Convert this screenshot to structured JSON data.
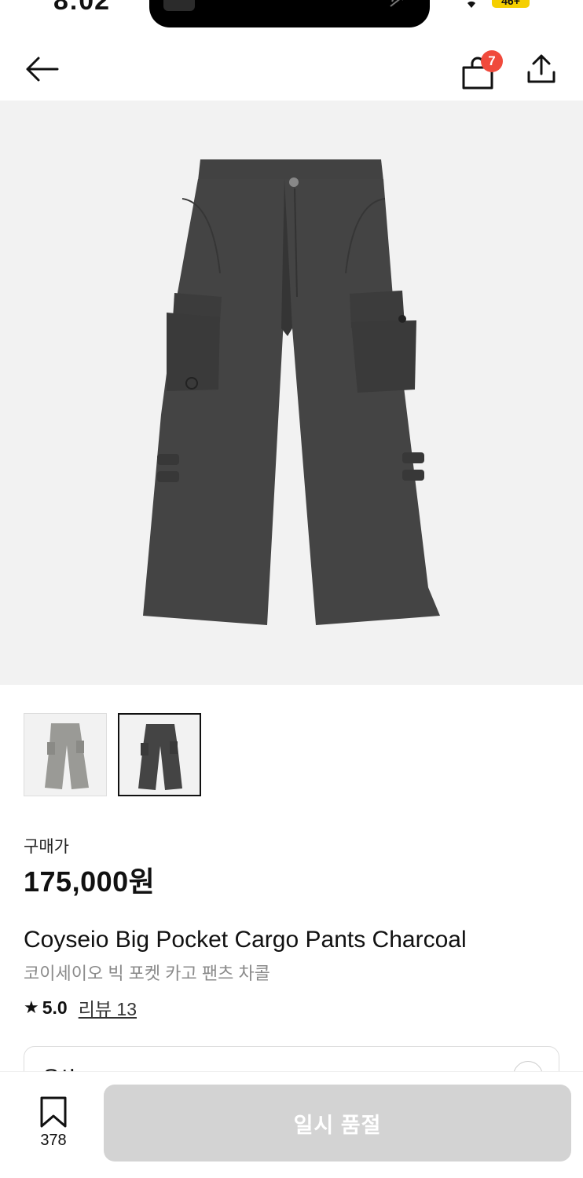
{
  "status": {
    "time": "8:02",
    "battery": "46+"
  },
  "nav": {
    "cart_count": "7"
  },
  "product": {
    "price_label": "구매가",
    "price": "175,000원",
    "name_en": "Coyseio Big Pocket Cargo Pants Charcoal",
    "name_ko": "코이세이오 빅 포켓 카고 팬츠 차콜",
    "rating": "5.0",
    "reviews": "리뷰 13"
  },
  "option": {
    "label": "옵션"
  },
  "bottom": {
    "bookmark_count": "378",
    "cta_label": "일시 품절"
  },
  "colors": {
    "badge": "#f04a3c",
    "cta_disabled": "#d3d3d3",
    "image_bg": "#f2f2f2"
  },
  "icons": [
    "back-arrow-icon",
    "shopping-bag-icon",
    "share-icon",
    "star-icon",
    "bookmark-icon"
  ]
}
